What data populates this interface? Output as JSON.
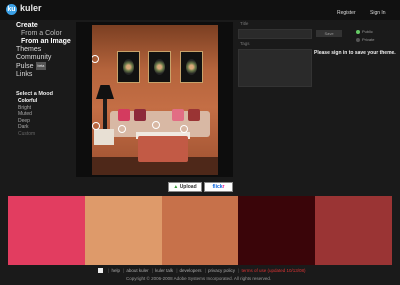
{
  "app": {
    "logo_icon": "ku",
    "name": "kuler"
  },
  "top_links": {
    "register": "Register",
    "signin": "Sign In"
  },
  "nav": {
    "create": "Create",
    "from_color": "From a Color",
    "from_image": "From an Image",
    "themes": "Themes",
    "community": "Community",
    "pulse": "Pulse",
    "pulse_badge": "beta",
    "links": "Links"
  },
  "mood": {
    "title": "Select a Mood",
    "options": [
      "Colorful",
      "Bright",
      "Muted",
      "Deep",
      "Dark",
      "Custom"
    ],
    "selected": "Colorful"
  },
  "buttons": {
    "upload": "Upload",
    "upload_icon": "up-arrow-icon",
    "flickr_a": "flick",
    "flickr_b": "r"
  },
  "form": {
    "title_label": "Title",
    "tags_label": "Tags",
    "save_label": "Save",
    "public_label": "Public",
    "private_label": "Private",
    "signin_message": "Please sign in to save your theme."
  },
  "swatches": [
    "#e23d60",
    "#de9a6a",
    "#c7714a",
    "#3a0509",
    "#9a3434"
  ],
  "footer": {
    "links": [
      "help",
      "about kuler",
      "kuler talk",
      "developers",
      "privacy policy",
      "terms of use (updated 10/13/08)"
    ],
    "copyright": "Copyright © 2006-2008 Adobe Systems Incorporated. All rights reserved."
  }
}
